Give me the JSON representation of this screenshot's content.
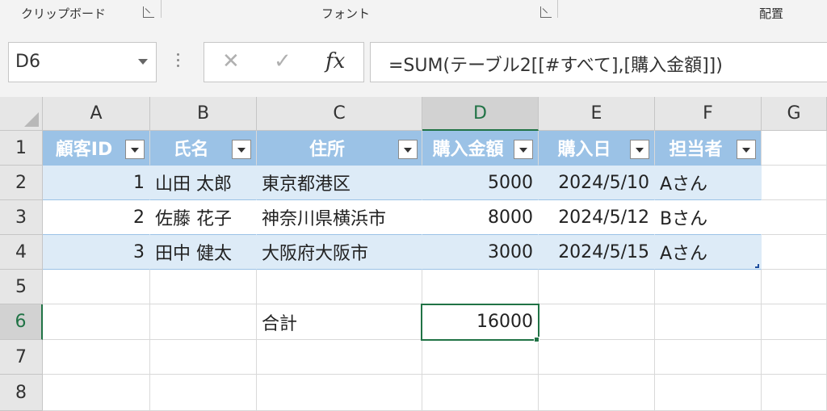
{
  "ribbon": {
    "groups": [
      {
        "label": "クリップボード"
      },
      {
        "label": "フォント"
      },
      {
        "label": "配置"
      }
    ]
  },
  "formula_bar": {
    "name_box": "D6",
    "cancel_glyph": "✕",
    "enter_glyph": "✓",
    "fx_label": "fx",
    "formula": "=SUM(テーブル2[[#すべて],[購入金額]])"
  },
  "columns": [
    "A",
    "B",
    "C",
    "D",
    "E",
    "F",
    "G"
  ],
  "rows": [
    "1",
    "2",
    "3",
    "4",
    "5",
    "6",
    "7",
    "8"
  ],
  "table": {
    "headers": [
      "顧客ID",
      "氏名",
      "住所",
      "購入金額",
      "購入日",
      "担当者"
    ],
    "data": [
      [
        "1",
        "山田 太郎",
        "東京都港区",
        "5000",
        "2024/5/10",
        "Aさん"
      ],
      [
        "2",
        "佐藤 花子",
        "神奈川県横浜市",
        "8000",
        "2024/5/12",
        "Bさん"
      ],
      [
        "3",
        "田中 健太",
        "大阪府大阪市",
        "3000",
        "2024/5/15",
        "Aさん"
      ]
    ]
  },
  "total": {
    "label": "合計",
    "value": "16000"
  },
  "selection": {
    "active_cell": "D6"
  },
  "colors": {
    "accent": "#217346",
    "table_header": "#9bc2e6",
    "table_band": "#ddebf7"
  }
}
